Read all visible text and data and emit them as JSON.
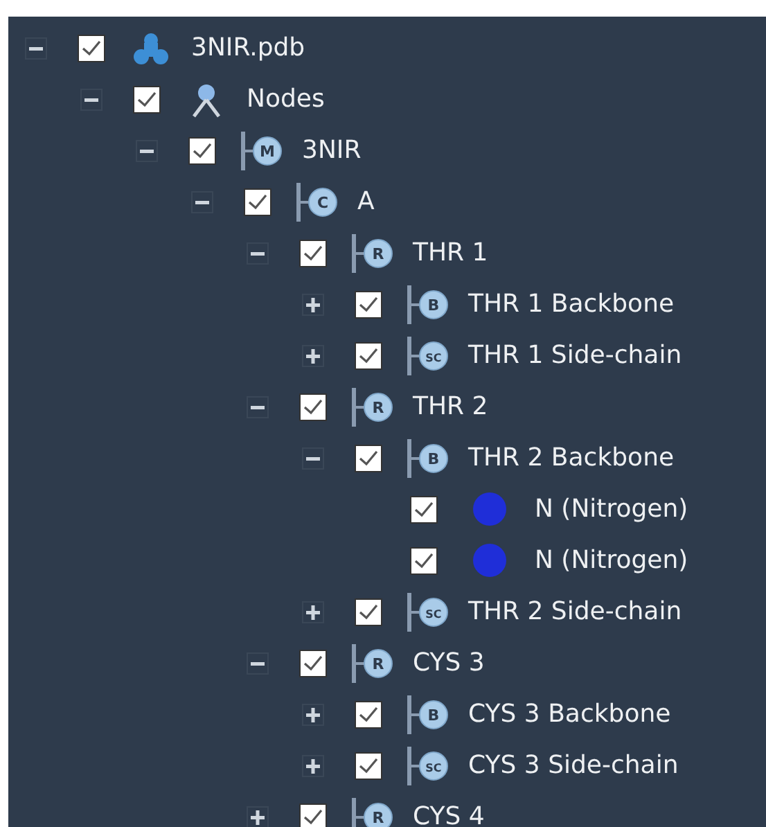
{
  "tree": [
    {
      "kind": "file",
      "label": "3NIR.pdb",
      "checked": true,
      "expanded": true,
      "children": [
        {
          "kind": "nodes",
          "label": "Nodes",
          "checked": true,
          "expanded": true,
          "children": [
            {
              "kind": "badge",
              "badge": "M",
              "label": "3NIR",
              "checked": true,
              "expanded": true,
              "children": [
                {
                  "kind": "badge",
                  "badge": "C",
                  "label": "A",
                  "checked": true,
                  "expanded": true,
                  "children": [
                    {
                      "kind": "badge",
                      "badge": "R",
                      "label": "THR 1",
                      "checked": true,
                      "expanded": true,
                      "children": [
                        {
                          "kind": "badge",
                          "badge": "B",
                          "label": "THR 1 Backbone",
                          "checked": true,
                          "expanded": false
                        },
                        {
                          "kind": "badge",
                          "badge": "SC",
                          "label": "THR 1 Side-chain",
                          "checked": true,
                          "expanded": false
                        }
                      ]
                    },
                    {
                      "kind": "badge",
                      "badge": "R",
                      "label": "THR 2",
                      "checked": true,
                      "expanded": true,
                      "children": [
                        {
                          "kind": "badge",
                          "badge": "B",
                          "label": "THR 2 Backbone",
                          "checked": true,
                          "expanded": true,
                          "children": [
                            {
                              "kind": "atom",
                              "label": "N (Nitrogen)",
                              "checked": true,
                              "color": "#1f2ed8"
                            },
                            {
                              "kind": "atom",
                              "label": "N (Nitrogen)",
                              "checked": true,
                              "color": "#1f2ed8"
                            }
                          ]
                        },
                        {
                          "kind": "badge",
                          "badge": "SC",
                          "label": "THR 2 Side-chain",
                          "checked": true,
                          "expanded": false
                        }
                      ]
                    },
                    {
                      "kind": "badge",
                      "badge": "R",
                      "label": "CYS 3",
                      "checked": true,
                      "expanded": true,
                      "children": [
                        {
                          "kind": "badge",
                          "badge": "B",
                          "label": "CYS 3 Backbone",
                          "checked": true,
                          "expanded": false
                        },
                        {
                          "kind": "badge",
                          "badge": "SC",
                          "label": "CYS 3 Side-chain",
                          "checked": true,
                          "expanded": false
                        }
                      ]
                    },
                    {
                      "kind": "badge",
                      "badge": "R",
                      "label": "CYS 4",
                      "checked": true,
                      "expanded": false
                    }
                  ]
                }
              ]
            }
          ]
        }
      ]
    }
  ]
}
